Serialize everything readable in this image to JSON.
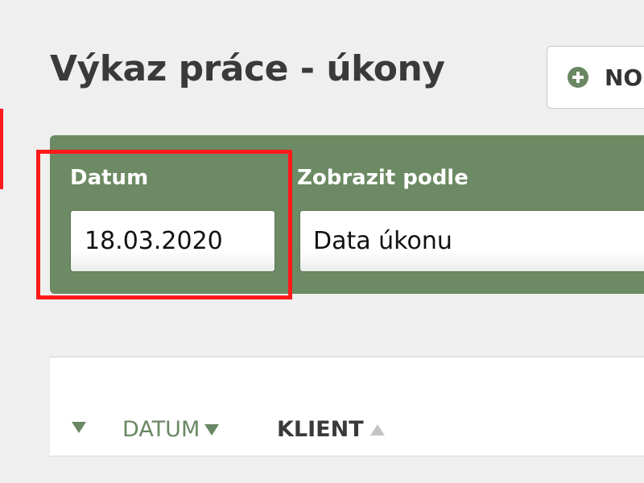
{
  "header": {
    "title": "Výkaz práce - úkony",
    "new_button_label": "NO",
    "new_button_icon": "plus-circle-icon"
  },
  "filters": {
    "date_label": "Datum",
    "date_value": "18.03.2020",
    "view_label": "Zobrazit podle",
    "view_value": "Data úkonu"
  },
  "table": {
    "toggle_icon": "caret-down-icon",
    "columns": [
      {
        "label": "DATUM",
        "sort": "descending",
        "active": true
      },
      {
        "label": "KLIENT",
        "sort": "ascending",
        "active": false
      }
    ]
  },
  "colors": {
    "accent_green": "#6c8a63",
    "highlight_red": "#ff1a1a",
    "title_text": "#3a3a3a"
  }
}
